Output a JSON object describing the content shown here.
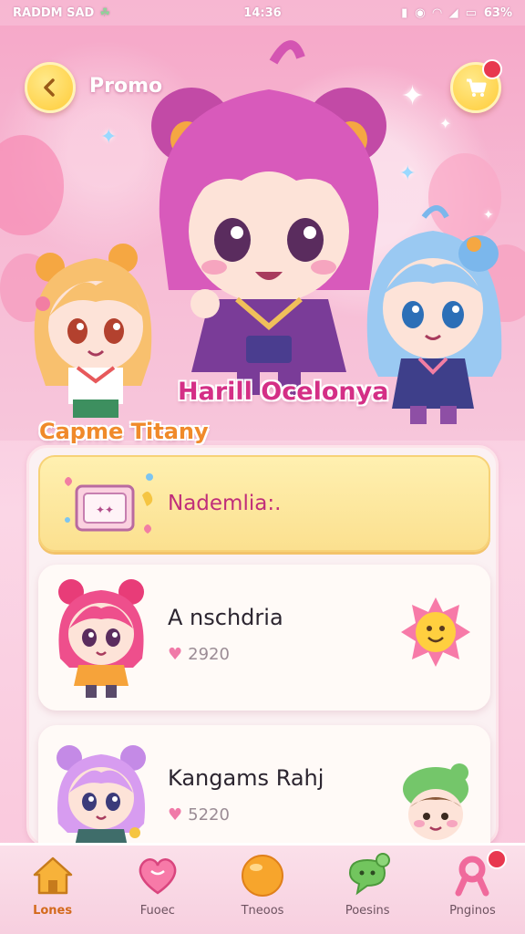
{
  "status_bar": {
    "carrier": "RADDM SAD",
    "time": "14:36",
    "battery": "63%"
  },
  "header": {
    "title": "Promo",
    "back_icon": "chevron-left-icon",
    "cart_icon": "shopping-cart-icon"
  },
  "hero": {
    "main_character_name": "Harill Ocelonya",
    "side_character_name": "Capme Titany"
  },
  "promo_card": {
    "label": "Nademlia:."
  },
  "items": [
    {
      "title": "A nschdria",
      "likes": "2920"
    },
    {
      "title": "Kangams Rahj",
      "likes": "5220"
    }
  ],
  "bottom_nav": [
    {
      "label": "Lones",
      "icon": "home-icon",
      "active": true
    },
    {
      "label": "Fuoec",
      "icon": "heart-icon",
      "active": false
    },
    {
      "label": "Tneoos",
      "icon": "orb-icon",
      "active": false
    },
    {
      "label": "Poesins",
      "icon": "chat-icon",
      "active": false
    },
    {
      "label": "Pnginos",
      "icon": "ribbon-icon",
      "active": false
    }
  ],
  "colors": {
    "accent_yellow": "#ffcc38",
    "brand_pink": "#d42f86",
    "badge_red": "#e8384f"
  }
}
